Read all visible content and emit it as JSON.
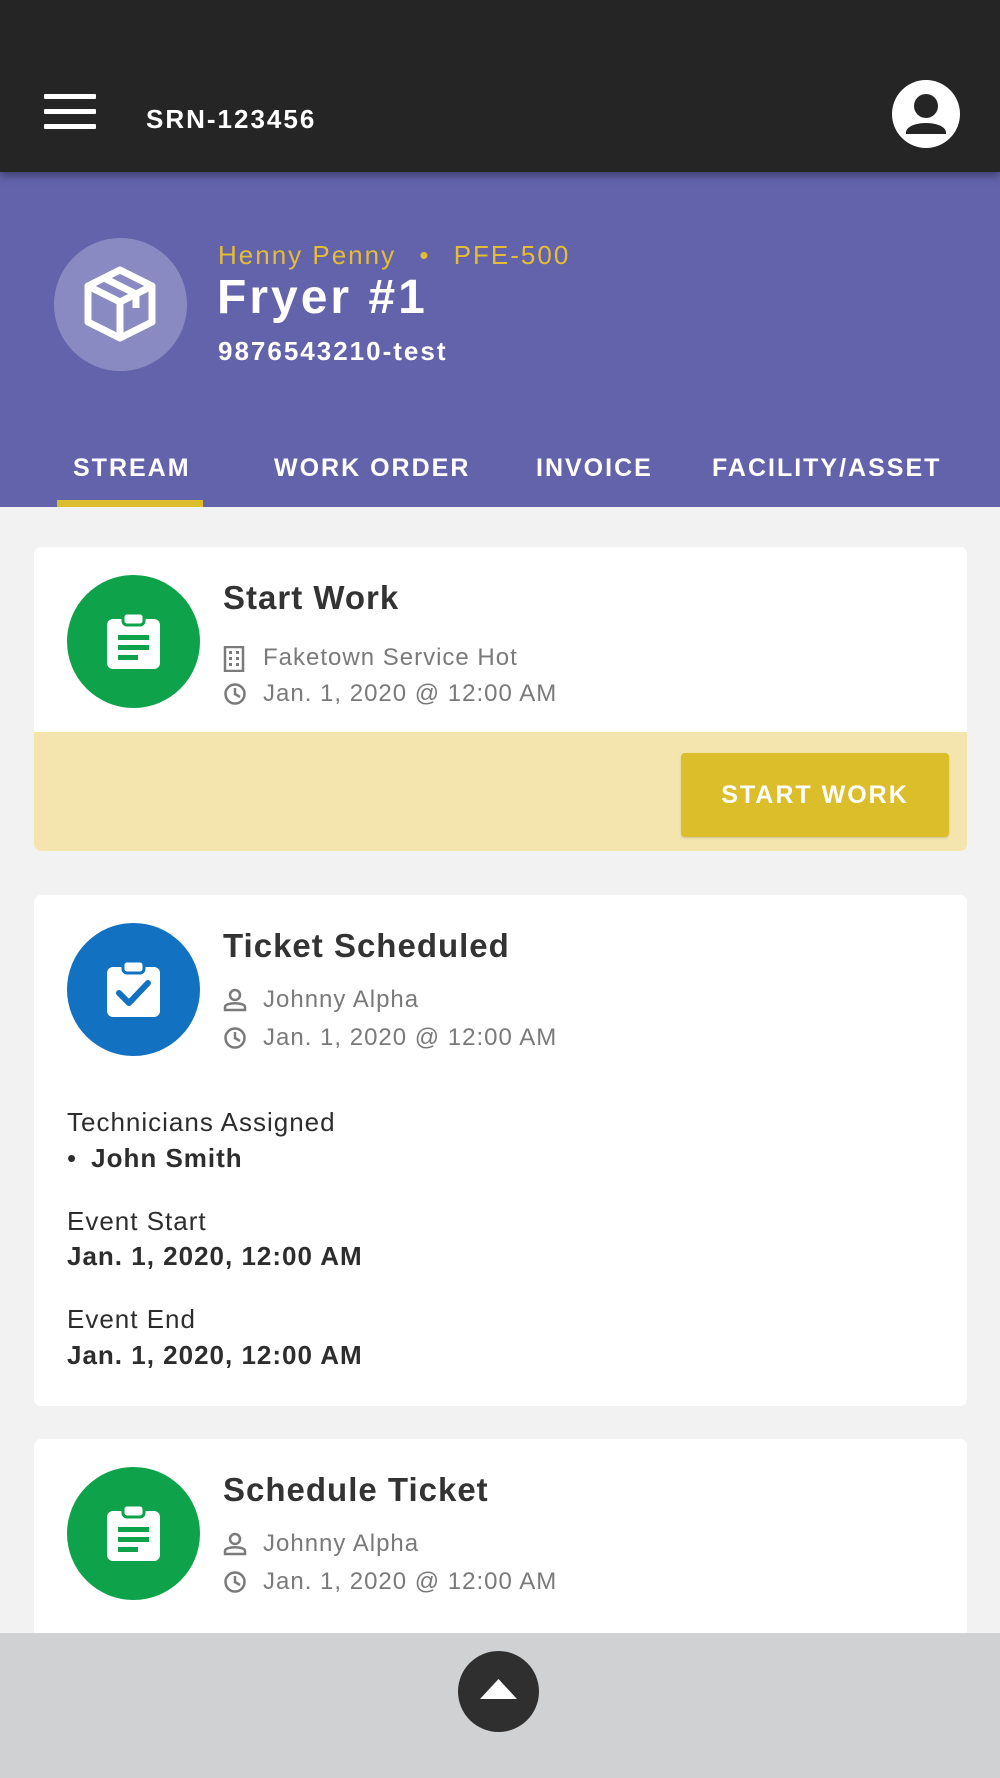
{
  "topbar": {
    "title": "SRN-123456"
  },
  "asset": {
    "brand": "Henny Penny",
    "separator": "•",
    "model": "PFE-500",
    "name": "Fryer #1",
    "serial": "9876543210-test"
  },
  "tabs": [
    {
      "label": "STREAM",
      "active": true
    },
    {
      "label": "WORK ORDER",
      "active": false
    },
    {
      "label": "INVOICE",
      "active": false
    },
    {
      "label": "FACILITY/ASSET",
      "active": false
    }
  ],
  "stream": [
    {
      "title": "Start Work",
      "icon": "clipboard-list-icon",
      "icon_color": "#0ea34a",
      "location": "Faketown Service Hot",
      "datetime": "Jan. 1, 2020 @ 12:00 AM",
      "action_label": "START WORK"
    },
    {
      "title": "Ticket Scheduled",
      "icon": "clipboard-check-icon",
      "icon_color": "#1271c1",
      "user": "Johnny Alpha",
      "datetime": "Jan. 1, 2020 @ 12:00 AM",
      "technicians_label": "Technicians Assigned",
      "technicians": [
        "John Smith"
      ],
      "event_start_label": "Event Start",
      "event_start": "Jan. 1, 2020, 12:00 AM",
      "event_end_label": "Event End",
      "event_end": "Jan. 1, 2020, 12:00 AM"
    },
    {
      "title": "Schedule Ticket",
      "icon": "clipboard-list-icon",
      "icon_color": "#0ea34a",
      "user": "Johnny Alpha",
      "datetime": "Jan. 1, 2020 @ 12:00 AM"
    }
  ],
  "colors": {
    "topbar": "#252525",
    "header": "#6363ac",
    "accent": "#dcbd2e",
    "action_band": "#f3e5ad"
  }
}
